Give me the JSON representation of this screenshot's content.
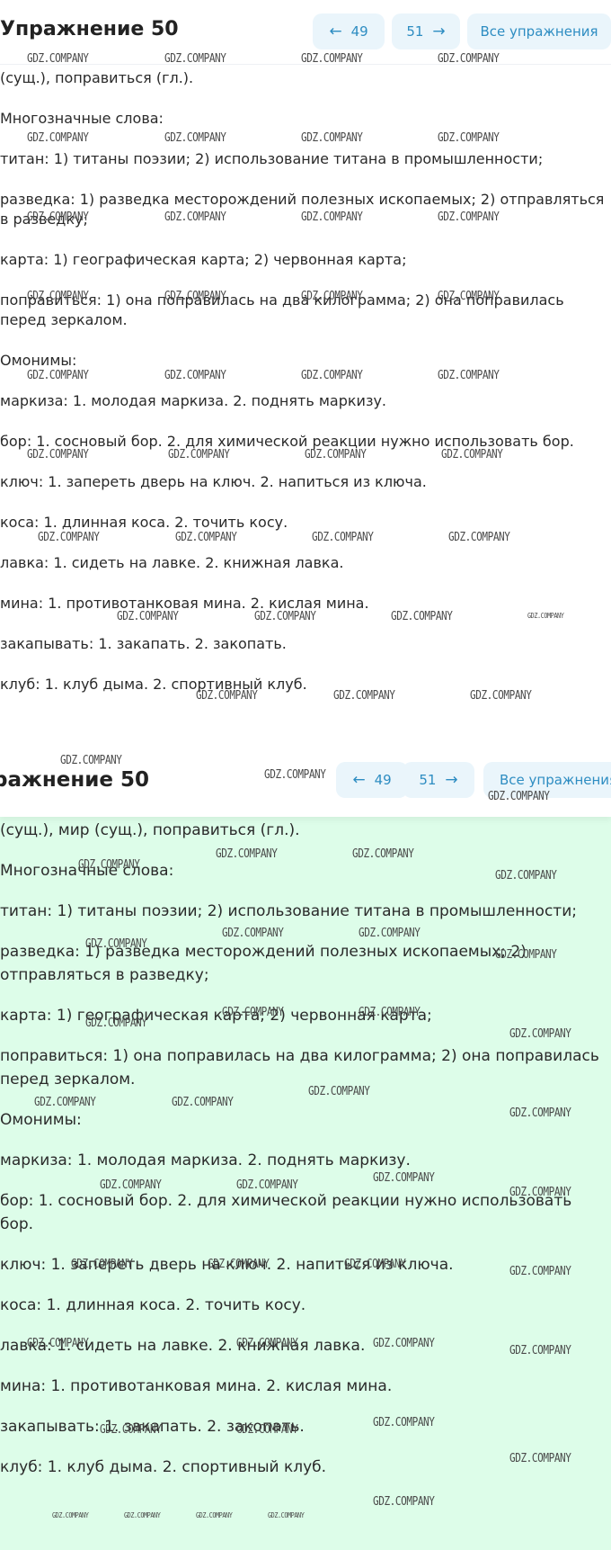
{
  "watermark": "GDZ.COMPANY",
  "accent_color": "#2e8dc2",
  "button_bg": "#eaf5fb",
  "solution_bg": "#ddfde9",
  "top": {
    "title": "Упражнение 50",
    "prev_label": "49",
    "next_label": "51",
    "all_label": "Все упражнения",
    "prev_icon": "arrow-left-icon",
    "next_icon": "arrow-right-icon",
    "paragraphs": [
      "(сущ.), поправиться (гл.).",
      "Многозначные слова:",
      "титан: 1) титаны поэзии; 2) использование титана в промышленности;",
      "разведка: 1) разведка месторождений полезных ископаемых; 2) отправляться\nв разведку;",
      "карта: 1) географическая карта; 2) червонная карта;",
      "поправиться: 1) она поправилась на два килограмма; 2) она поправилась\nперед зеркалом.",
      "Омонимы:",
      "маркиза: 1. молодая маркиза. 2. поднять маркизу.",
      "бор: 1. сосновый бор. 2. для химической реакции нужно использовать бор.",
      "ключ: 1. запереть дверь на ключ. 2. напиться из ключа.",
      "коса: 1. длинная коса. 2. точить косу.",
      "лавка: 1. сидеть на лавке. 2. книжная лавка.",
      "мина: 1. противотанковая мина. 2. кислая мина.",
      "закапывать: 1. закапать. 2. закопать.",
      "клуб: 1. клуб дыма. 2. спортивный клуб."
    ]
  },
  "bottom": {
    "title": "ражнение 50",
    "prev_label": "49",
    "next_label": "51",
    "all_label": "Все упражнения",
    "prev_icon": "arrow-left-icon",
    "next_icon": "arrow-right-icon",
    "paragraphs": [
      "(сущ.), мир (сущ.), поправиться (гл.).",
      "Многозначные слова:",
      "титан: 1) титаны поэзии; 2) использование титана в промышленности;",
      "разведка: 1) разведка месторождений полезных ископаемых; 2)\nотправляться в разведку;",
      "карта: 1) географическая карта; 2) червонная карта;",
      "поправиться: 1) она поправилась на два килограмма; 2) она поправилась\nперед зеркалом.",
      "Омонимы:",
      "маркиза: 1. молодая маркиза. 2. поднять маркизу.",
      "бор: 1. сосновый бор. 2. для химической реакции нужно использовать\nбор.",
      "ключ: 1. запереть дверь на ключ. 2. напиться из ключа.",
      "коса: 1. длинная коса. 2. точить косу.",
      "лавка: 1. сидеть на лавке. 2. книжная лавка.",
      "мина: 1. противотанковая мина. 2. кислая мина.",
      "закапывать: 1. закапать. 2. закопать.",
      "клуб: 1. клуб дыма. 2. спортивный клуб."
    ]
  }
}
